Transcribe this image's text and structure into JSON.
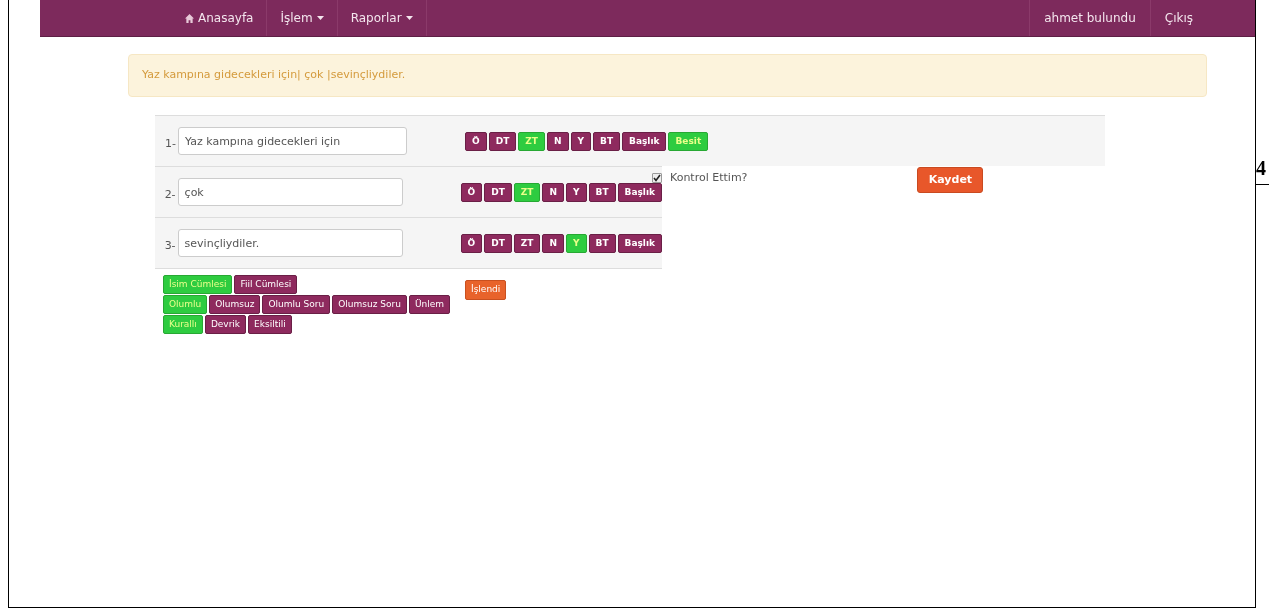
{
  "navbar": {
    "left": [
      {
        "label": "Anasayfa",
        "kind": "home"
      },
      {
        "label": "İşlem",
        "kind": "dropdown"
      },
      {
        "label": "Raporlar",
        "kind": "dropdown"
      }
    ],
    "right": [
      "ahmet bulundu",
      "Çıkış"
    ]
  },
  "alert": "Yaz kampına gidecekleri için| çok |sevinçliydiler.",
  "rows": [
    {
      "number": "1-",
      "value": "Yaz kampına gidecekleri için",
      "tags": [
        {
          "label": "Ö",
          "selected": false
        },
        {
          "label": "DT",
          "selected": false
        },
        {
          "label": "ZT",
          "selected": true
        },
        {
          "label": "N",
          "selected": false
        },
        {
          "label": "Y",
          "selected": false
        },
        {
          "label": "BT",
          "selected": false
        },
        {
          "label": "Başlık",
          "selected": false
        },
        {
          "label": "Besit",
          "selected": true
        }
      ]
    },
    {
      "number": "2-",
      "value": "çok",
      "tags": [
        {
          "label": "Ö",
          "selected": false
        },
        {
          "label": "DT",
          "selected": false
        },
        {
          "label": "ZT",
          "selected": true
        },
        {
          "label": "N",
          "selected": false
        },
        {
          "label": "Y",
          "selected": false
        },
        {
          "label": "BT",
          "selected": false
        },
        {
          "label": "Başlık",
          "selected": false
        }
      ]
    },
    {
      "number": "3-",
      "value": "sevinçliydiler.",
      "tags": [
        {
          "label": "Ö",
          "selected": false
        },
        {
          "label": "DT",
          "selected": false
        },
        {
          "label": "ZT",
          "selected": false
        },
        {
          "label": "N",
          "selected": false
        },
        {
          "label": "Y",
          "selected": true
        },
        {
          "label": "BT",
          "selected": false
        },
        {
          "label": "Başlık",
          "selected": false
        }
      ]
    }
  ],
  "control": {
    "label": "Kontrol Ettim?",
    "checked": true
  },
  "save_button": "Kaydet",
  "sentence_groups": [
    [
      {
        "label": "İsim Cümlesi",
        "selected": true
      },
      {
        "label": "Fiil Cümlesi",
        "selected": false
      }
    ],
    [
      {
        "label": "Olumlu",
        "selected": true
      },
      {
        "label": "Olumsuz",
        "selected": false
      },
      {
        "label": "Olumlu Soru",
        "selected": false
      },
      {
        "label": "Olumsuz Soru",
        "selected": false
      },
      {
        "label": "Ünlem",
        "selected": false
      }
    ],
    [
      {
        "label": "Kurallı",
        "selected": true
      },
      {
        "label": "Devrik",
        "selected": false
      },
      {
        "label": "Eksiltili",
        "selected": false
      }
    ]
  ],
  "processed_button": "İşlendi",
  "page_number": "4"
}
